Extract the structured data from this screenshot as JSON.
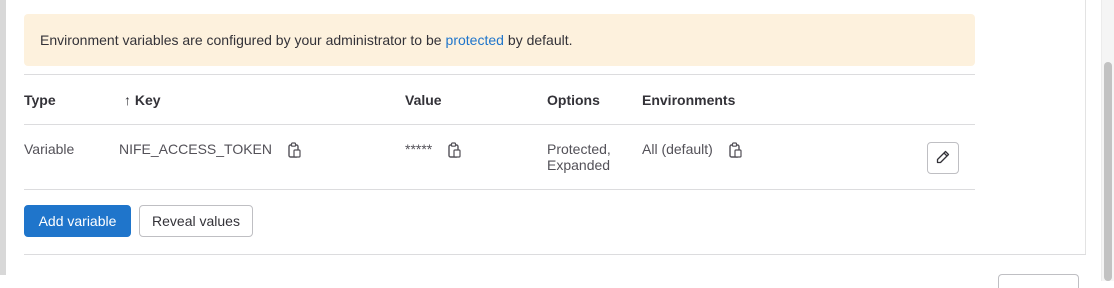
{
  "alert": {
    "text_before": "Environment variables are configured by your administrator to be",
    "link": "protected",
    "text_after": "by default."
  },
  "table": {
    "headers": {
      "type": "Type",
      "sort_arrow": "↑",
      "key": "Key",
      "value": "Value",
      "options": "Options",
      "environments": "Environments"
    },
    "rows": [
      {
        "type": "Variable",
        "key": "NIFE_ACCESS_TOKEN",
        "value": "*****",
        "options_line1": "Protected,",
        "options_line2": "Expanded",
        "environment": "All (default)"
      }
    ]
  },
  "actions": {
    "add_label": "Add variable",
    "reveal_label": "Reveal values"
  },
  "colors": {
    "primary": "#1f75cb",
    "alert_bg": "#fdf1dd"
  }
}
